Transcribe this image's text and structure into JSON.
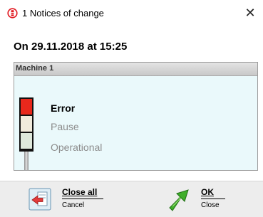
{
  "window": {
    "title": "1 Notices of change",
    "close_glyph": "✕",
    "app_icon": "signal-tower-icon",
    "accent_color": "#e0141c"
  },
  "notice": {
    "timestamp": "On 29.11.2018 at 15:25"
  },
  "machine_panel": {
    "header": "Machine 1",
    "background_color": "#eaf9fb",
    "states": [
      {
        "label": "Error",
        "active": true,
        "lamp_color": "#e8281c",
        "text_color": "#000000"
      },
      {
        "label": "Pause",
        "active": false,
        "lamp_color": "#f1ebdc",
        "text_color": "#8c8c8c"
      },
      {
        "label": "Operational",
        "active": false,
        "lamp_color": "#dfe9dc",
        "text_color": "#8c8c8c"
      }
    ]
  },
  "footer": {
    "close_all": {
      "label": "Close all",
      "sublabel": "Cancel",
      "icon": "close-all-icon"
    },
    "ok": {
      "label": "OK",
      "sublabel": "Close",
      "icon": "green-check-arrow-icon"
    }
  }
}
